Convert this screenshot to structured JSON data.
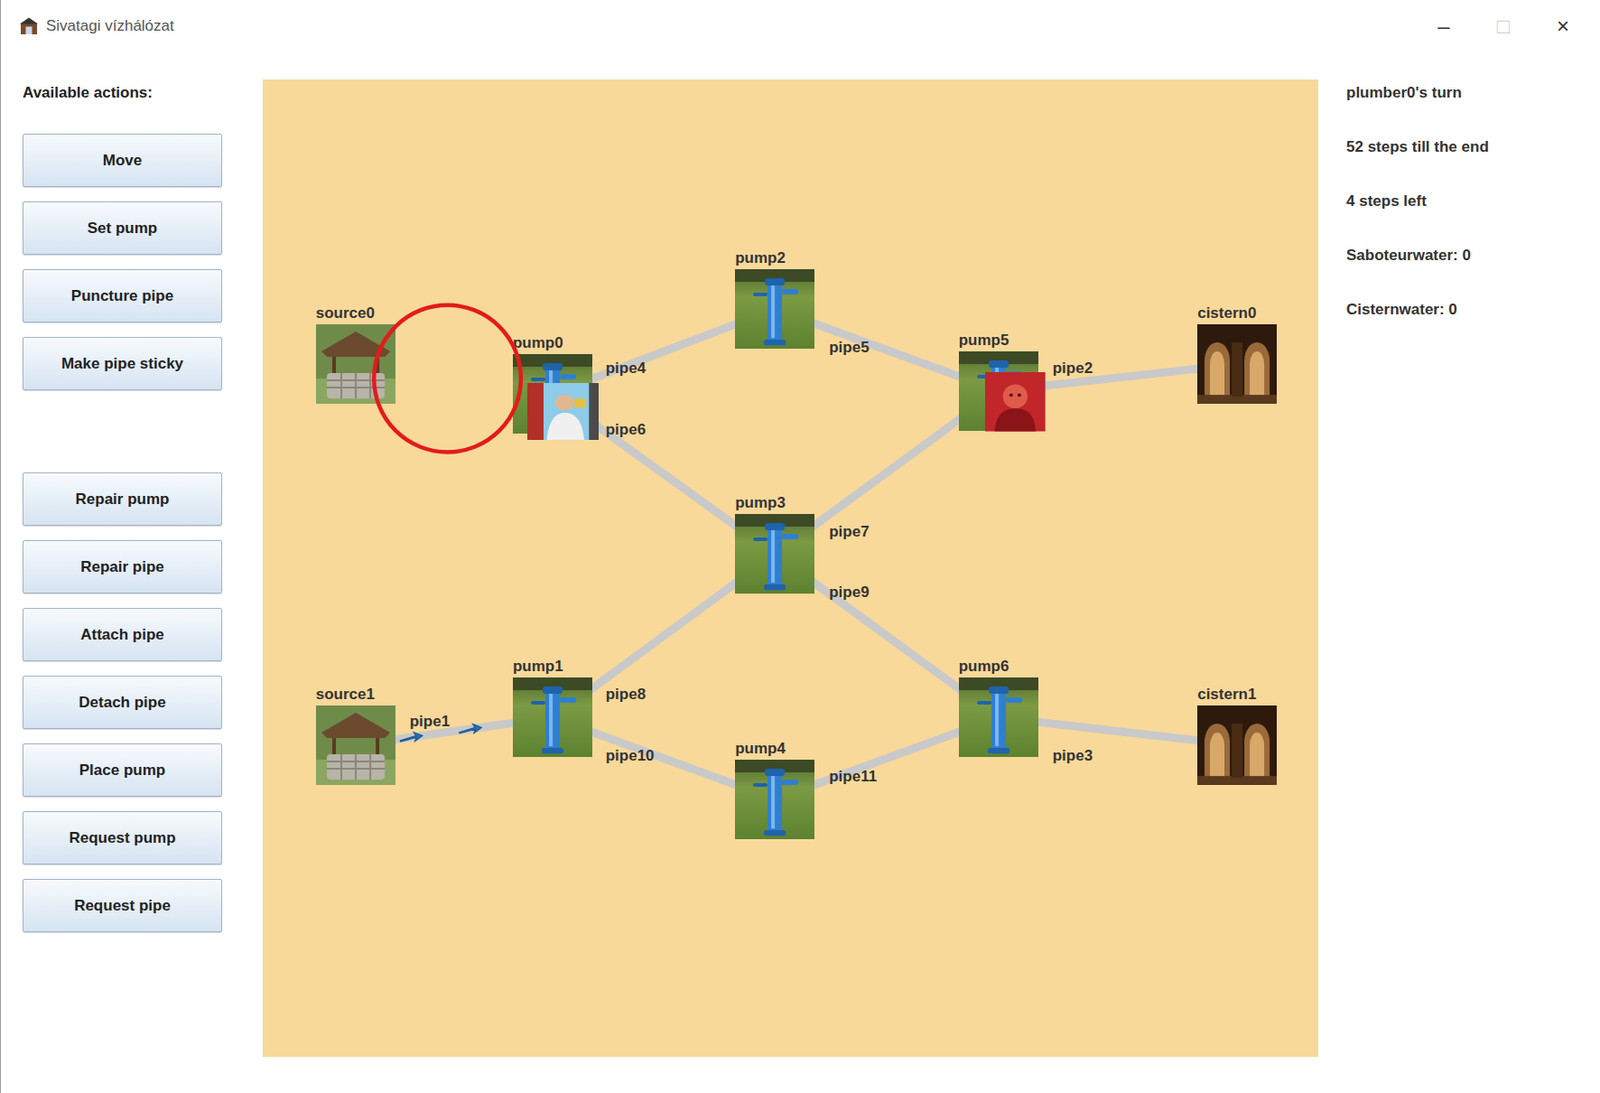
{
  "window": {
    "title": "Sivatagi vízhálózat",
    "controls": [
      {
        "label": "–",
        "disabled": false
      },
      {
        "label": "□",
        "disabled": true
      },
      {
        "label": "×",
        "disabled": false
      }
    ]
  },
  "actions": {
    "heading": "Available actions:",
    "groups": [
      [
        "Move",
        "Set pump",
        "Puncture pipe",
        "Make pipe sticky"
      ],
      [
        "Repair pump",
        "Repair pipe",
        "Attach pipe",
        "Detach pipe",
        "Place pump",
        "Request pump",
        "Request pipe"
      ]
    ]
  },
  "status": [
    "plumber0's turn",
    "52 steps till the end",
    "4 steps left",
    "Saboteurwater: 0",
    "Cisternwater: 0"
  ],
  "network": {
    "nodes": [
      {
        "label": "source0",
        "kind": "source"
      },
      {
        "label": "pump0",
        "kind": "pump"
      },
      {
        "label": "pump2",
        "kind": "pump"
      },
      {
        "label": "pump5",
        "kind": "pump"
      },
      {
        "label": "cistern0",
        "kind": "cistern"
      },
      {
        "label": "pump3",
        "kind": "pump"
      },
      {
        "label": "source1",
        "kind": "source"
      },
      {
        "label": "pump1",
        "kind": "pump"
      },
      {
        "label": "pump4",
        "kind": "pump"
      },
      {
        "label": "pump6",
        "kind": "pump"
      },
      {
        "label": "cistern1",
        "kind": "cistern"
      }
    ],
    "pipes": [
      {
        "label": "pipe1",
        "ends": [
          "source1",
          "pump1"
        ],
        "flowing": true
      },
      {
        "label": "pipe2",
        "ends": [
          "pump5",
          "cistern0"
        ],
        "flowing": false
      },
      {
        "label": "pipe3",
        "ends": [
          "pump6",
          "cistern1"
        ],
        "flowing": false
      },
      {
        "label": "pipe4",
        "ends": [
          "pump0",
          "pump2"
        ],
        "flowing": false
      },
      {
        "label": "pipe5",
        "ends": [
          "pump2",
          "pump5"
        ],
        "flowing": false
      },
      {
        "label": "pipe6",
        "ends": [
          "pump0",
          "pump3"
        ],
        "flowing": false
      },
      {
        "label": "pipe7",
        "ends": [
          "pump3",
          "pump5"
        ],
        "flowing": false
      },
      {
        "label": "pipe8",
        "ends": [
          "pump1",
          "pump3"
        ],
        "flowing": false
      },
      {
        "label": "pipe9",
        "ends": [
          "pump3",
          "pump6"
        ],
        "flowing": false
      },
      {
        "label": "pipe10",
        "ends": [
          "pump1",
          "pump4"
        ],
        "flowing": false
      },
      {
        "label": "pipe11",
        "ends": [
          "pump4",
          "pump6"
        ],
        "flowing": false
      }
    ],
    "players": [
      {
        "kind": "plumber",
        "node": "pump0"
      },
      {
        "kind": "saboteur",
        "node": "pump5"
      }
    ]
  },
  "annotations": [
    {
      "kind": "circle",
      "color": "#e31b1b"
    }
  ]
}
